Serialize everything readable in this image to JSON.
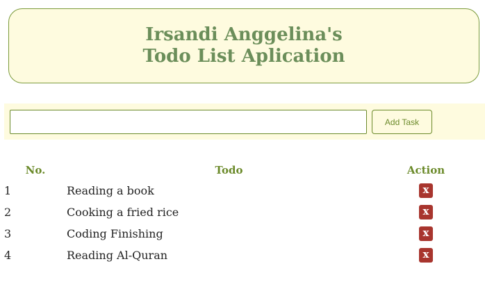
{
  "header": {
    "title_line1": "Irsandi Anggelina's",
    "title_line2": "Todo List Aplication"
  },
  "form": {
    "input_value": "",
    "add_button_label": "Add Task"
  },
  "table": {
    "columns": [
      "No.",
      "Todo",
      "Action"
    ],
    "rows": [
      {
        "no": "1",
        "todo": "Reading a book",
        "action": "x"
      },
      {
        "no": "2",
        "todo": "Cooking a fried rice",
        "action": "x"
      },
      {
        "no": "3",
        "todo": "Coding Finishing",
        "action": "x"
      },
      {
        "no": "4",
        "todo": "Reading Al-Quran",
        "action": "x"
      }
    ]
  },
  "colors": {
    "accent": "#6b8a2a",
    "title": "#6b8e5a",
    "panel_bg": "#fefbdf",
    "delete_bg": "#a8352e"
  }
}
